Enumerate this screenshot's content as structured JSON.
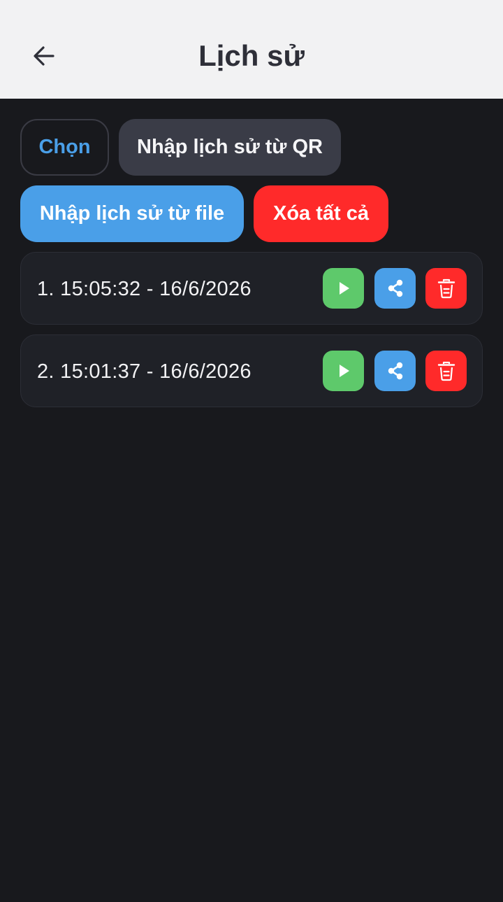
{
  "header": {
    "title": "Lịch sử",
    "back_icon": "arrow-left-icon"
  },
  "actions": {
    "select_label": "Chọn",
    "import_qr_label": "Nhập lịch sử từ QR",
    "import_file_label": "Nhập lịch sử từ file",
    "clear_all_label": "Xóa tất cả"
  },
  "history": [
    {
      "label": "1. 15:05:32 - 16/6/2026",
      "icons": [
        "play-icon",
        "share-icon",
        "trash-icon"
      ]
    },
    {
      "label": "2. 15:01:37 - 16/6/2026",
      "icons": [
        "play-icon",
        "share-icon",
        "trash-icon"
      ]
    }
  ],
  "colors": {
    "background": "#18191d",
    "header_bg": "#f2f2f3",
    "accent_blue": "#4a9fe8",
    "play_green": "#5ec96b",
    "danger_red": "#ff2a2a",
    "secondary_button": "#3a3c47",
    "card_bg": "#1f2127"
  }
}
